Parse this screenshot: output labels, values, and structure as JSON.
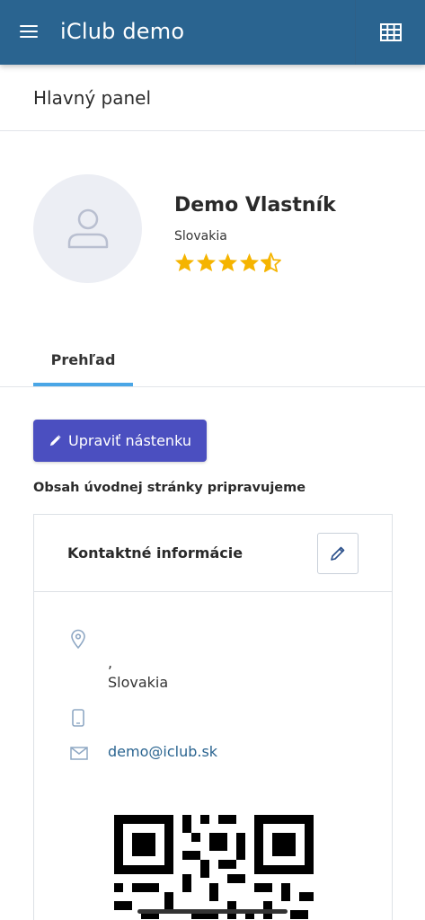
{
  "app": {
    "title": "iClub demo"
  },
  "page": {
    "title": "Hlavný panel"
  },
  "profile": {
    "name": "Demo Vlastník",
    "country": "Slovakia",
    "rating": 4.5,
    "rating_max": 5
  },
  "tabs": [
    {
      "label": "Prehľad",
      "active": true
    }
  ],
  "dashboard": {
    "edit_label": "Upraviť nástenku",
    "notice": "Obsah úvodnej stránky pripravujeme"
  },
  "contact": {
    "title": "Kontaktné informácie",
    "address_line1": ",",
    "address_line2": "Slovakia",
    "email": "demo@iclub.sk"
  },
  "icons": {
    "menu": "hamburger-icon",
    "grid": "table-grid-icon",
    "avatar": "user-icon",
    "edit": "pencil-icon",
    "location": "map-pin-icon",
    "phone": "mobile-phone-icon",
    "email": "envelope-icon"
  },
  "colors": {
    "appbar": "#2a6490",
    "accent_button": "#4b4fc0",
    "tab_underline": "#4aa6e6",
    "star": "#f5b400",
    "link": "#2a6490"
  }
}
